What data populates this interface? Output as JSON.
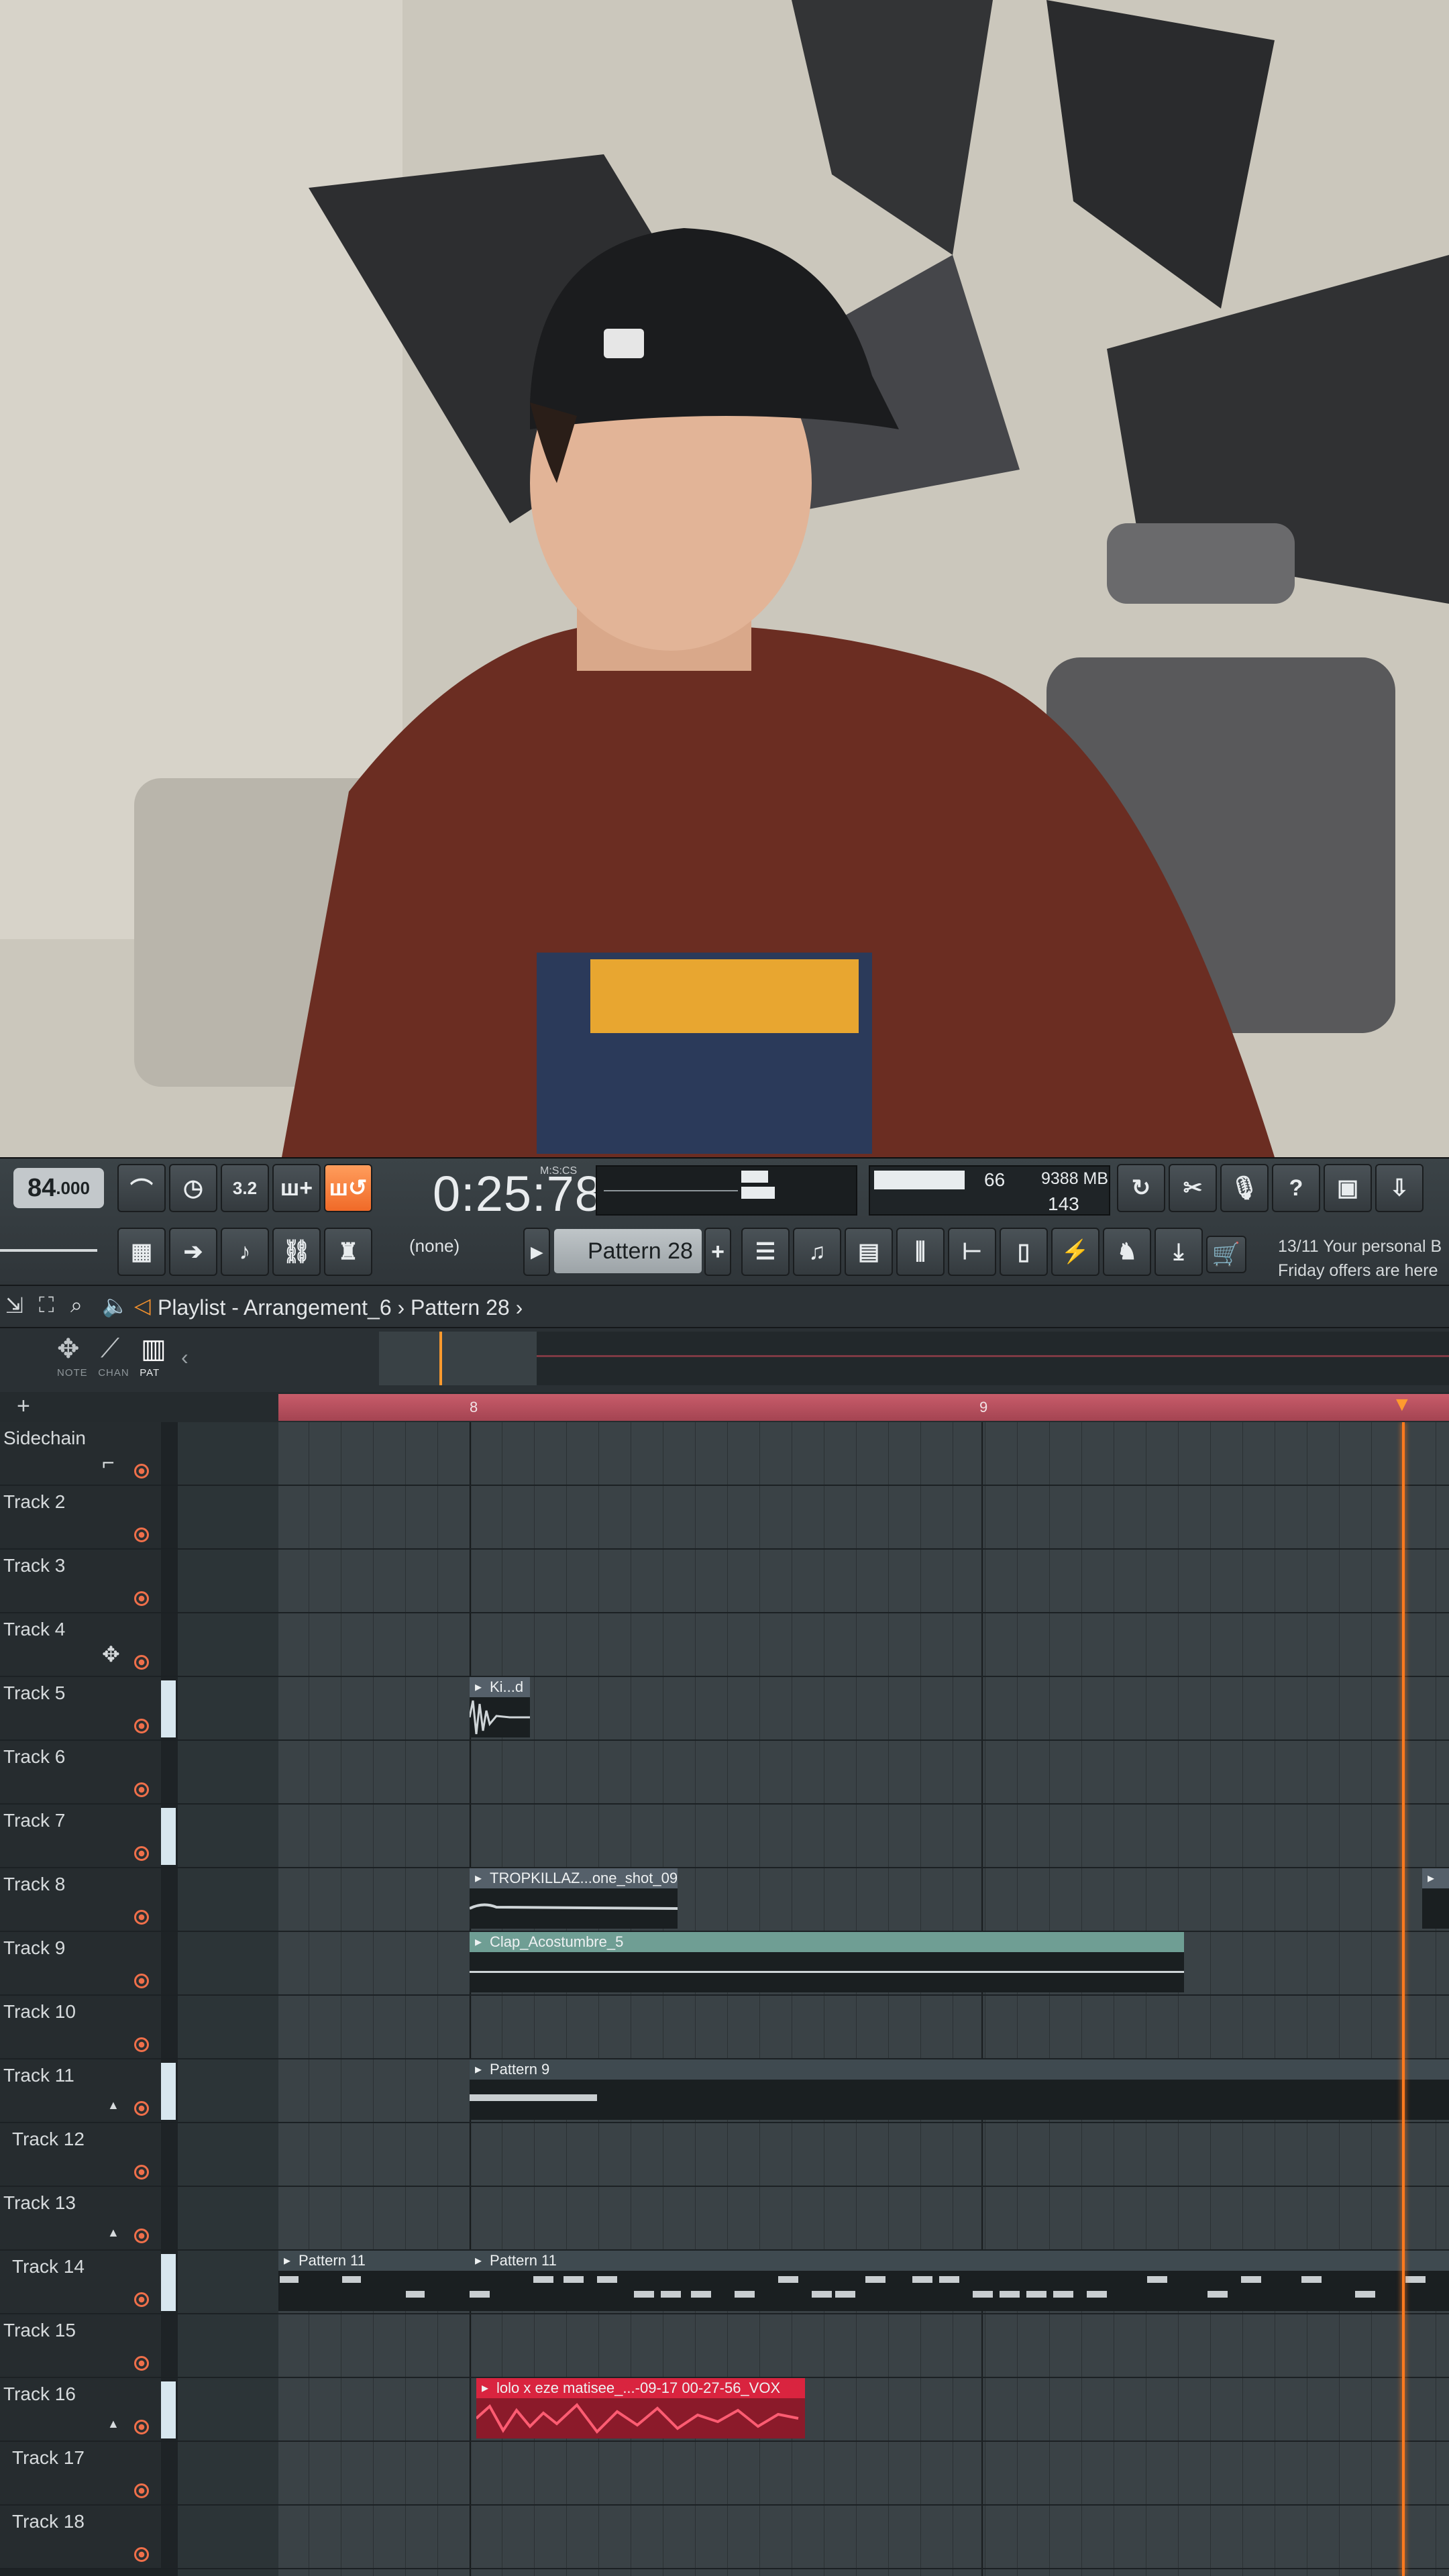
{
  "toolbar": {
    "tempo_value": "84",
    "tempo_decimal": ".000",
    "time_display": "0:25:78",
    "time_format_label": "M:S:CS",
    "cpu_value": "66",
    "memory": "9388 MB",
    "polyphony": "143",
    "pattern_selector": "Pattern 28",
    "channel_selector": "(none)",
    "news_line1": "13/11  Your personal B",
    "news_line2": "Friday offers are here"
  },
  "titlebar": {
    "title": "Playlist - Arrangement_6 › Pattern 28 ›"
  },
  "overview": {
    "tab_note": "NOTE",
    "tab_chan": "CHAN",
    "tab_pat": "PAT"
  },
  "ruler": {
    "marker_8": "8",
    "marker_9": "9"
  },
  "tracks": [
    {
      "label": "Sidechain"
    },
    {
      "label": "Track 2"
    },
    {
      "label": "Track 3"
    },
    {
      "label": "Track 4"
    },
    {
      "label": "Track 5"
    },
    {
      "label": "Track 6"
    },
    {
      "label": "Track 7"
    },
    {
      "label": "Track 8"
    },
    {
      "label": "Track 9"
    },
    {
      "label": "Track 10"
    },
    {
      "label": "Track 11"
    },
    {
      "label": "Track 12"
    },
    {
      "label": "Track 13"
    },
    {
      "label": "Track 14"
    },
    {
      "label": "Track 15"
    },
    {
      "label": "Track 16"
    },
    {
      "label": "Track 17"
    },
    {
      "label": "Track 18"
    }
  ],
  "clips": {
    "kick": "Ki...d",
    "tropkillaz": "TROPKILLAZ...one_shot_09",
    "clap": "Clap_Acostumbre_5",
    "pattern9": "Pattern 9",
    "pattern11a": "Pattern 11",
    "pattern11b": "Pattern 11",
    "vox": "lolo x eze matisee_...-09-17 00-27-56_VOX"
  },
  "colors": {
    "accent_orange": "#f06a28",
    "ruler_pink": "#c85c6a",
    "playhead": "#ff7a1e",
    "vox_red": "#d9243f",
    "clap_green": "#6f9e94"
  }
}
